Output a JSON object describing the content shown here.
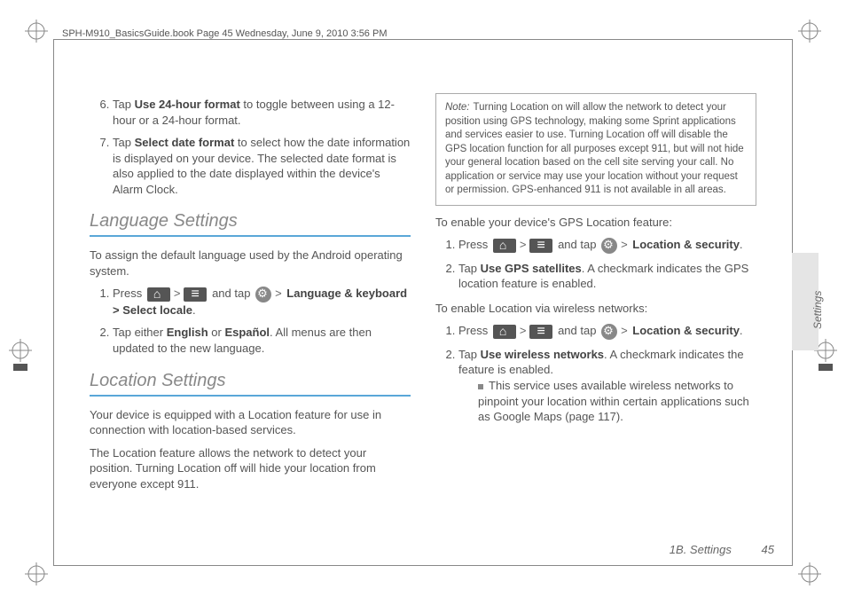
{
  "header": "SPH-M910_BasicsGuide.book  Page 45  Wednesday, June 9, 2010  3:56 PM",
  "left": {
    "steps_a": [
      {
        "n": 6,
        "pre": "Tap ",
        "bold": "Use 24-hour format",
        "post": " to toggle between using a 12-hour or a 24-hour format."
      },
      {
        "n": 7,
        "pre": "Tap ",
        "bold": "Select date format",
        "post": " to select how the date information is displayed on your device. The selected date format is also applied to the date displayed within the device's Alarm Clock."
      }
    ],
    "lang_heading": "Language Settings",
    "lang_intro": "To assign the default language used by the Android operating system.",
    "lang_steps": [
      {
        "n": 1,
        "text_pre": "Press ",
        "text_mid": " and tap ",
        "bold_tail": "Language & keyboard > Select locale",
        "tail_post": "."
      },
      {
        "n": 2,
        "text": "Tap either ",
        "bold1": "English",
        "mid": " or ",
        "bold2": "Español",
        "post": ". All menus are then updated to the new language."
      }
    ],
    "loc_heading": "Location Settings",
    "loc_p1": "Your device is equipped with a Location feature for use in connection with location-based services.",
    "loc_p2": "The Location feature allows the network to detect your position. Turning Location off will hide your location from everyone except 911."
  },
  "right": {
    "note_label": "Note:",
    "note_text": "Turning Location on will allow the network to detect your position using GPS technology, making some Sprint applications and services easier to use. Turning Location off will disable the GPS location function for all purposes except 911, but will not hide your general location based on the cell site serving your call. No application or service may use your location without your request or permission. GPS-enhanced 911 is not available in all areas.",
    "gps_head": "To enable your device's GPS Location feature:",
    "gps_steps": [
      {
        "n": 1,
        "pre": "Press ",
        "mid": " and tap ",
        "bold_tail": "Location & security",
        "post": "."
      },
      {
        "n": 2,
        "pre": "Tap ",
        "bold": "Use GPS satellites",
        "post": ". A checkmark indicates the GPS location feature is enabled."
      }
    ],
    "wifi_head": "To enable Location via wireless networks:",
    "wifi_steps": [
      {
        "n": 1,
        "pre": "Press ",
        "mid": " and tap ",
        "bold_tail": "Location & security",
        "post": "."
      },
      {
        "n": 2,
        "pre": "Tap ",
        "bold": "Use wireless networks",
        "post": ". A checkmark indicates the feature is enabled."
      }
    ],
    "bullet": "This service uses available wireless networks to pinpoint your location within certain applications such as Google Maps (page 117).",
    "sidetab": "Settings"
  },
  "footer": {
    "section": "1B. Settings",
    "page": "45"
  }
}
